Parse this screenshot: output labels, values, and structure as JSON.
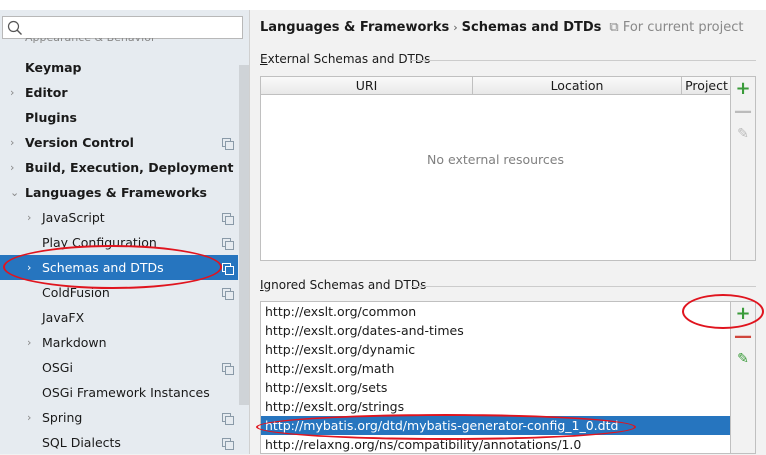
{
  "sidebar": {
    "search_placeholder": "",
    "cut_item": "Appearance & Behavior",
    "items": [
      {
        "label": "Keymap",
        "bold": true,
        "arrow": false,
        "proj": false,
        "indent": 0
      },
      {
        "label": "Editor",
        "bold": true,
        "arrow": true,
        "proj": false,
        "indent": 0
      },
      {
        "label": "Plugins",
        "bold": true,
        "arrow": false,
        "proj": false,
        "indent": 0
      },
      {
        "label": "Version Control",
        "bold": true,
        "arrow": true,
        "proj": true,
        "indent": 0
      },
      {
        "label": "Build, Execution, Deployment",
        "bold": true,
        "arrow": true,
        "proj": false,
        "indent": 0
      },
      {
        "label": "Languages & Frameworks",
        "bold": true,
        "arrow": "open",
        "proj": false,
        "indent": 0
      },
      {
        "label": "JavaScript",
        "bold": false,
        "arrow": true,
        "proj": true,
        "indent": 1
      },
      {
        "label": "Play Configuration",
        "bold": false,
        "arrow": false,
        "proj": true,
        "indent": 1
      },
      {
        "label": "Schemas and DTDs",
        "bold": false,
        "arrow": true,
        "proj": true,
        "indent": 1,
        "selected": true
      },
      {
        "label": "ColdFusion",
        "bold": false,
        "arrow": false,
        "proj": true,
        "indent": 1
      },
      {
        "label": "JavaFX",
        "bold": false,
        "arrow": false,
        "proj": false,
        "indent": 1
      },
      {
        "label": "Markdown",
        "bold": false,
        "arrow": true,
        "proj": false,
        "indent": 1
      },
      {
        "label": "OSGi",
        "bold": false,
        "arrow": false,
        "proj": true,
        "indent": 1
      },
      {
        "label": "OSGi Framework Instances",
        "bold": false,
        "arrow": false,
        "proj": false,
        "indent": 1
      },
      {
        "label": "Spring",
        "bold": false,
        "arrow": true,
        "proj": true,
        "indent": 1
      },
      {
        "label": "SQL Dialects",
        "bold": false,
        "arrow": false,
        "proj": true,
        "indent": 1
      }
    ]
  },
  "header": {
    "parent": "Languages & Frameworks",
    "separator": "›",
    "title": "Schemas and DTDs",
    "scope": "For current project"
  },
  "external": {
    "group_first": "E",
    "group_rest": "xternal Schemas and DTDs",
    "columns": [
      "URI",
      "Location",
      "Project"
    ],
    "empty_text": "No external resources"
  },
  "ignored": {
    "group_first": "I",
    "group_rest": "gnored Schemas and DTDs",
    "rows": [
      "http://exslt.org/common",
      "http://exslt.org/dates-and-times",
      "http://exslt.org/dynamic",
      "http://exslt.org/math",
      "http://exslt.org/sets",
      "http://exslt.org/strings",
      "http://mybatis.org/dtd/mybatis-generator-config_1_0.dtd",
      "http://relaxng.org/ns/compatibility/annotations/1.0"
    ],
    "selected_index": 6
  },
  "toolbar": {
    "add": "+",
    "remove": "—",
    "edit": "✎"
  },
  "colors": {
    "accent": "#2675bf",
    "annotation": "#e0141e",
    "add": "#3a9b3a"
  }
}
